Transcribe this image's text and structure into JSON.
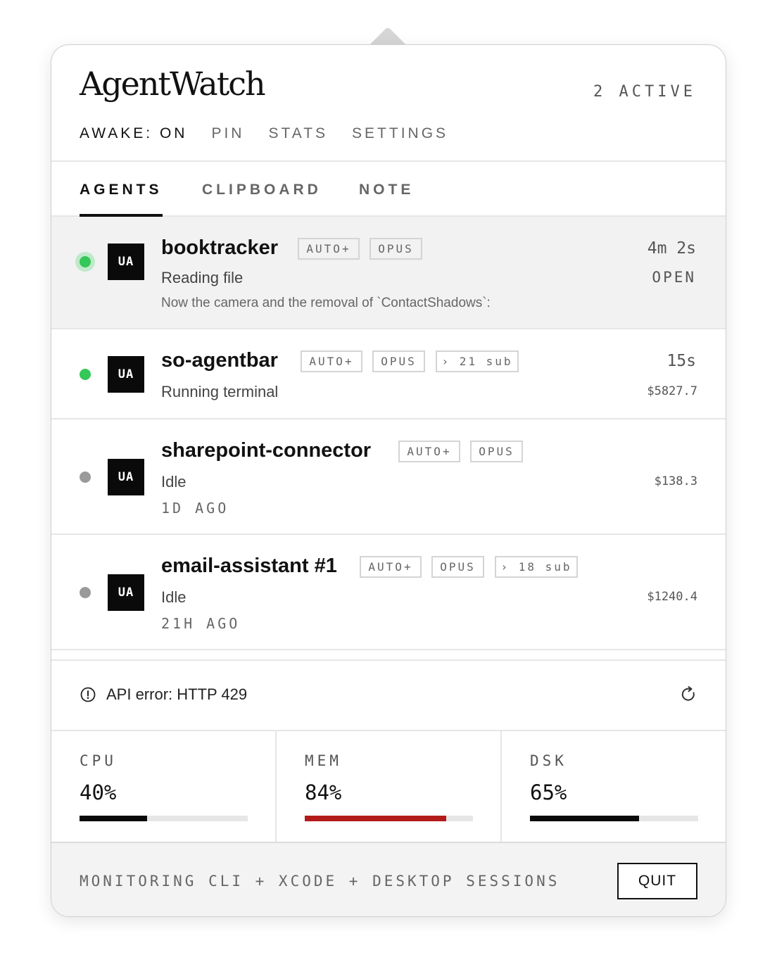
{
  "app": {
    "title": "AgentWatch",
    "active_count": "2 ACTIVE"
  },
  "topnav": {
    "awake": "AWAKE: ON",
    "pin": "PIN",
    "stats": "STATS",
    "settings": "SETTINGS"
  },
  "tabs": {
    "agents": "AGENTS",
    "clipboard": "CLIPBOARD",
    "note": "NOTE",
    "selected": "AGENTS"
  },
  "agents": [
    {
      "name": "booktracker",
      "avatar": "UA",
      "status_color": "green",
      "selected": true,
      "tags": [
        "AUTO+",
        "OPUS"
      ],
      "status": "Reading file",
      "detail": "Now the camera and the removal of `ContactShadows`:",
      "time": "4m 2s",
      "action": "OPEN"
    },
    {
      "name": "so-agentbar",
      "avatar": "UA",
      "status_color": "green",
      "tags": [
        "AUTO+",
        "OPUS",
        "› 21 sub"
      ],
      "status": "Running terminal",
      "time": "15s",
      "cost": "$5827.7"
    },
    {
      "name": "sharepoint-connector",
      "avatar": "UA",
      "status_color": "grey",
      "tags": [
        "AUTO+",
        "OPUS"
      ],
      "status": "Idle",
      "ago": "1D AGO",
      "cost": "$138.3"
    },
    {
      "name": "email-assistant #1",
      "avatar": "UA",
      "status_color": "grey",
      "tags": [
        "AUTO+",
        "OPUS",
        "› 18 sub"
      ],
      "status": "Idle",
      "ago": "21H AGO",
      "cost": "$1240.4"
    }
  ],
  "error": {
    "icon": "alert-circle-icon",
    "text": "API error: HTTP 429",
    "action_icon": "refresh-icon"
  },
  "stats": [
    {
      "label": "CPU",
      "value": "40%",
      "level": 0.4,
      "color": "#0a0a0a"
    },
    {
      "label": "MEM",
      "value": "84%",
      "level": 0.84,
      "color": "#b31b1b"
    },
    {
      "label": "DSK",
      "value": "65%",
      "level": 0.65,
      "color": "#0a0a0a"
    }
  ],
  "footer": {
    "text": "MONITORING CLI + XCODE + DESKTOP SESSIONS",
    "quit_label": "QUIT"
  },
  "colors": {
    "active_green": "#34c759",
    "idle_grey": "#9a9a9a",
    "mem_red": "#b31b1b"
  }
}
